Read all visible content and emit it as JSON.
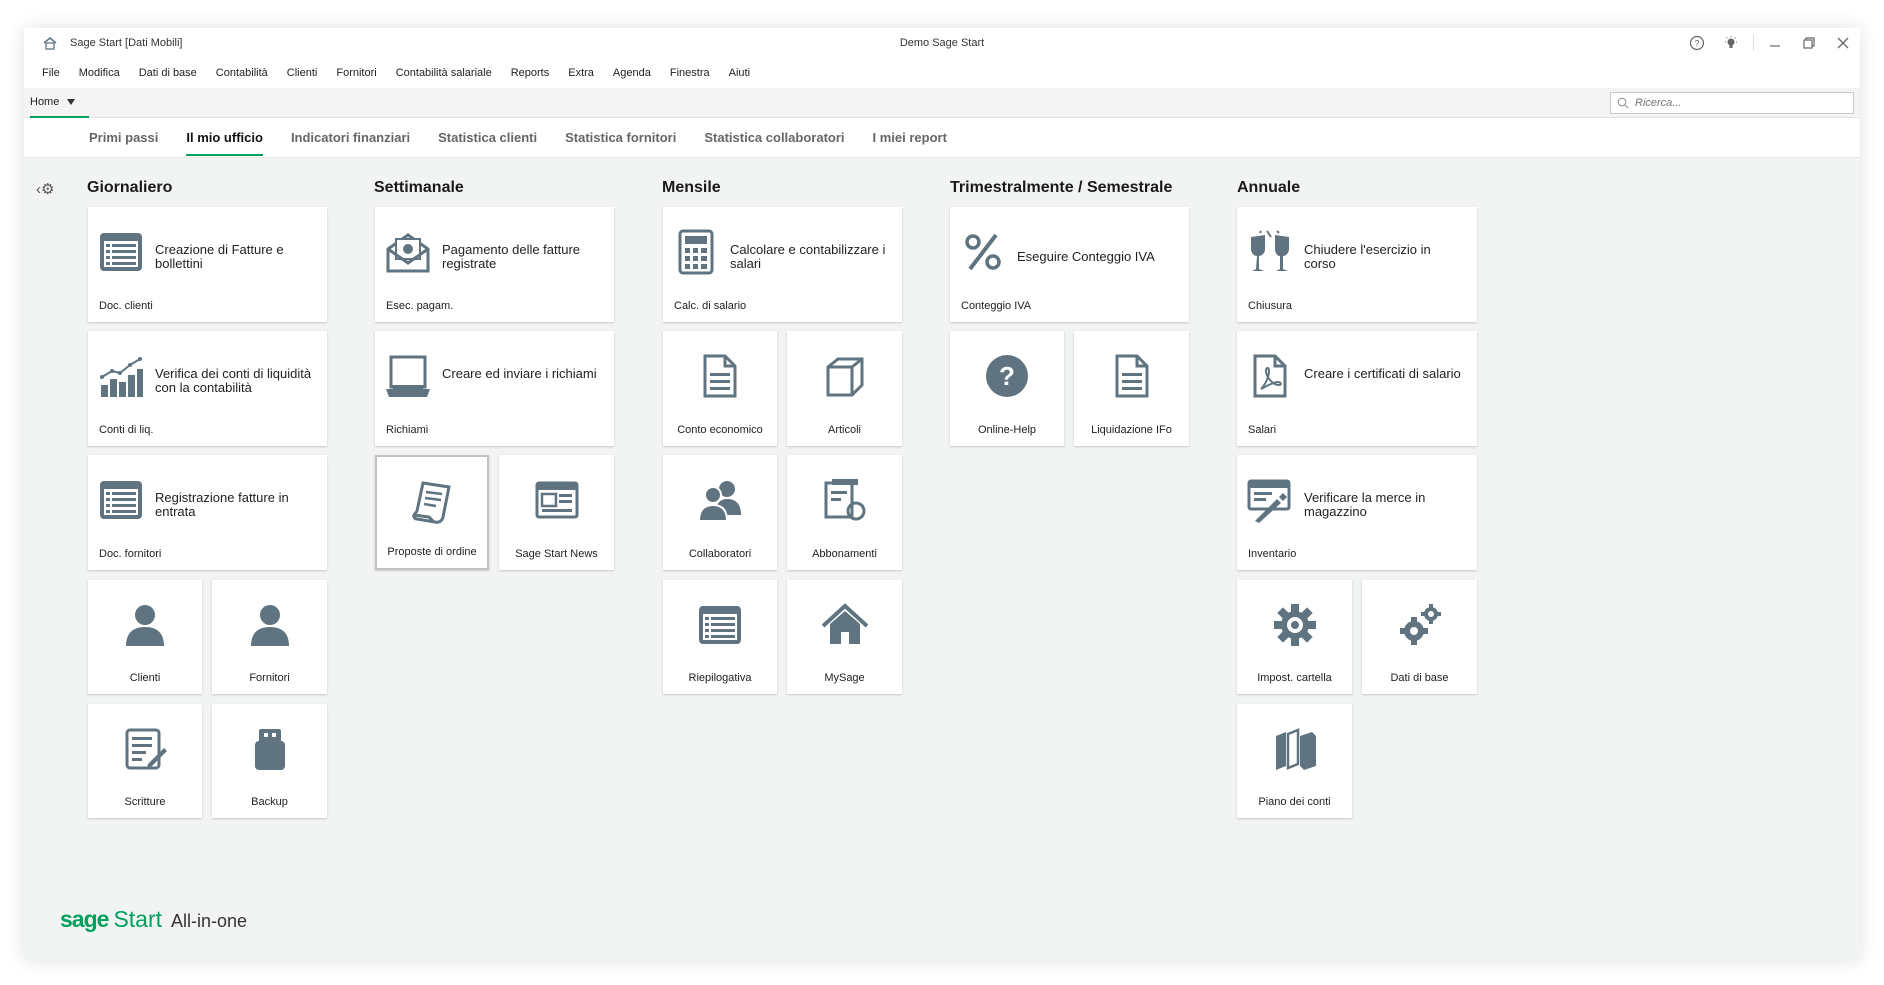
{
  "window": {
    "title": "Sage Start [Dati Mobili]",
    "center_title": "Demo Sage Start"
  },
  "menu": [
    "File",
    "Modifica",
    "Dati di base",
    "Contabilità",
    "Clienti",
    "Fornitori",
    "Contabilità salariale",
    "Reports",
    "Extra",
    "Agenda",
    "Finestra",
    "Aiuti"
  ],
  "home": {
    "label": "Home"
  },
  "search": {
    "placeholder": "Ricerca..."
  },
  "tabs": [
    "Primi passi",
    "Il mio ufficio",
    "Indicatori finanziari",
    "Statistica clienti",
    "Statistica fornitori",
    "Statistica collaboratori",
    "I miei report"
  ],
  "active_tab": "Il mio ufficio",
  "columns": [
    "Giornaliero",
    "Settimanale",
    "Mensile",
    "Trimestralmente / Semestrale",
    "Annuale"
  ],
  "tiles": {
    "doc_clienti": {
      "desc": "Creazione di Fatture e bollettini",
      "label": "Doc. clienti",
      "icon": "list-document-icon"
    },
    "conti_liq": {
      "desc": "Verifica dei conti di liquidità con la contabilità",
      "label": "Conti di liq.",
      "icon": "chart-growth-icon"
    },
    "doc_fornitori": {
      "desc": "Registrazione fatture in entrata",
      "label": "Doc. fornitori",
      "icon": "list-document-icon"
    },
    "clienti": {
      "label": "Clienti",
      "icon": "person-icon"
    },
    "fornitori": {
      "label": "Fornitori",
      "icon": "person-icon"
    },
    "scritture": {
      "label": "Scritture",
      "icon": "edit-document-icon"
    },
    "backup": {
      "label": "Backup",
      "icon": "usb-drive-icon"
    },
    "esec_pagam": {
      "desc": "Pagamento delle fatture registrate",
      "label": "Esec. pagam.",
      "icon": "envelope-money-icon"
    },
    "richiami": {
      "desc": "Creare ed inviare i richiami",
      "label": "Richiami",
      "icon": "laptop-icon"
    },
    "proposte": {
      "label": "Proposte di ordine",
      "icon": "order-note-icon"
    },
    "news": {
      "label": "Sage Start News",
      "icon": "newspaper-icon"
    },
    "calc_salario": {
      "desc": "Calcolare e contabilizzare i salari",
      "label": "Calc. di salario",
      "icon": "calculator-icon"
    },
    "conto_econ": {
      "label": "Conto economico",
      "icon": "document-icon"
    },
    "articoli": {
      "label": "Articoli",
      "icon": "box-icon"
    },
    "collaboratori": {
      "label": "Collaboratori",
      "icon": "people-icon"
    },
    "abbonamenti": {
      "label": "Abbonamenti",
      "icon": "subscription-icon"
    },
    "riepilogativa": {
      "label": "Riepilogativa",
      "icon": "list-document-icon"
    },
    "mysage": {
      "label": "MySage",
      "icon": "home-icon"
    },
    "conteggio_iva": {
      "desc": "Eseguire Conteggio IVA",
      "label": "Conteggio IVA",
      "icon": "percent-icon"
    },
    "online_help": {
      "label": "Online-Help",
      "icon": "question-icon"
    },
    "liquid_ifo": {
      "label": "Liquidazione IFo",
      "icon": "document-icon"
    },
    "chiusura": {
      "desc": "Chiudere l'esercizio in corso",
      "label": "Chiusura",
      "icon": "champagne-icon"
    },
    "salari": {
      "desc": "Creare i certificati di salario",
      "label": "Salari",
      "icon": "pdf-document-icon"
    },
    "inventario": {
      "desc": "Verificare la merce in magazzino",
      "label": "Inventario",
      "icon": "inventory-icon"
    },
    "impost_cartella": {
      "label": "Impost. cartella",
      "icon": "gear-icon"
    },
    "dati_base": {
      "label": "Dati di base",
      "icon": "gears-icon"
    },
    "piano_conti": {
      "label": "Piano dei conti",
      "icon": "books-icon"
    }
  },
  "brand": {
    "name": "sage",
    "product": "Start",
    "edition": "All-in-one"
  },
  "colors": {
    "accent": "#00a15d",
    "icon": "#5f7480"
  }
}
